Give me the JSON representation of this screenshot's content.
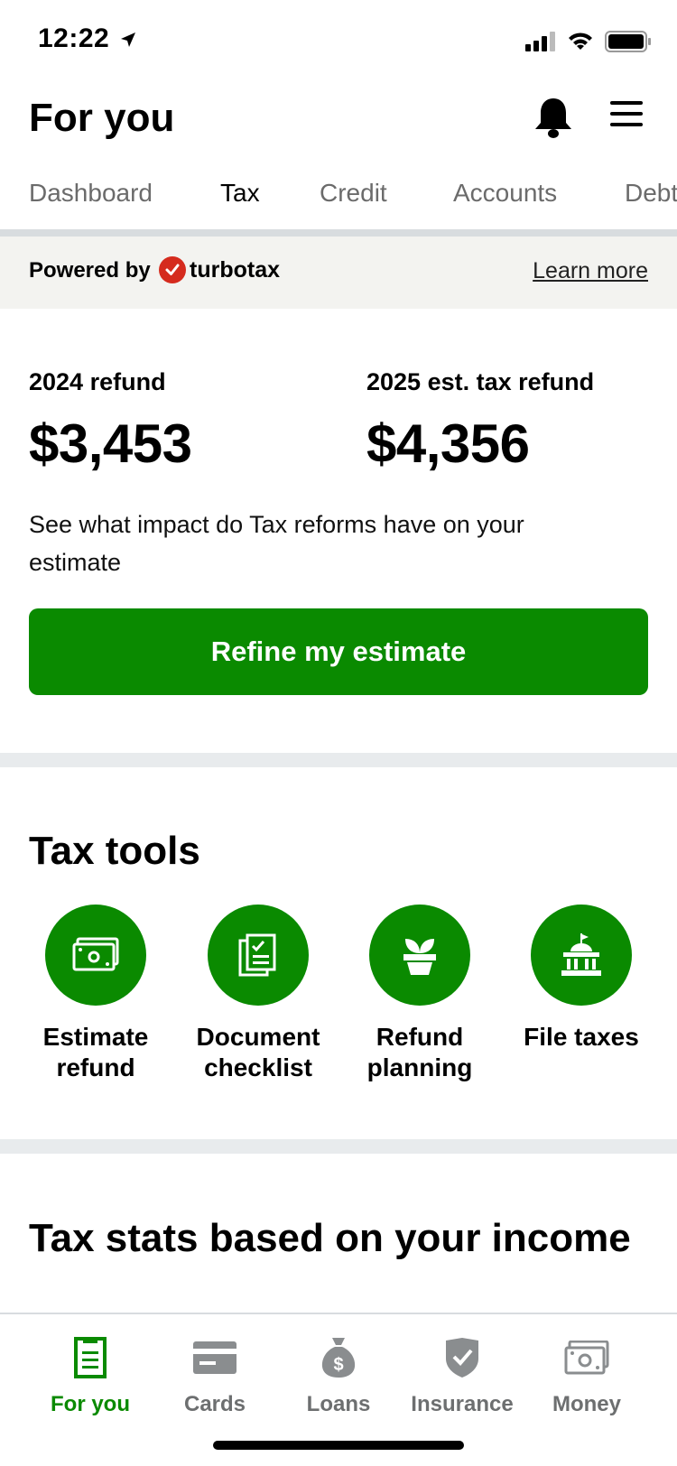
{
  "status_bar": {
    "time": "12:22"
  },
  "header": {
    "title": "For you"
  },
  "tabs": [
    {
      "label": "Dashboard"
    },
    {
      "label": "Tax"
    },
    {
      "label": "Credit"
    },
    {
      "label": "Accounts"
    },
    {
      "label": "Debt"
    }
  ],
  "active_tab": "Tax",
  "powered_by": {
    "label": "Powered by",
    "brand": "turbotax",
    "link": "Learn more"
  },
  "refunds": {
    "current": {
      "label": "2024 refund",
      "value": "$3,453"
    },
    "estimate": {
      "label": "2025 est. tax refund",
      "value": "$4,356"
    },
    "description": "See what impact do Tax reforms have on your estimate",
    "cta": "Refine my estimate"
  },
  "tax_tools": {
    "title": "Tax tools",
    "items": [
      {
        "label": "Estimate refund",
        "icon": "money-bill-icon"
      },
      {
        "label": "Document checklist",
        "icon": "checklist-icon"
      },
      {
        "label": "Refund planning",
        "icon": "plant-pot-icon"
      },
      {
        "label": "File taxes",
        "icon": "government-building-icon"
      }
    ]
  },
  "tax_stats": {
    "title": "Tax stats based on your income"
  },
  "bottom_nav": [
    {
      "label": "For you",
      "icon": "document-icon",
      "active": true
    },
    {
      "label": "Cards",
      "icon": "credit-card-icon"
    },
    {
      "label": "Loans",
      "icon": "money-bag-icon"
    },
    {
      "label": "Insurance",
      "icon": "shield-check-icon"
    },
    {
      "label": "Money",
      "icon": "money-bill-icon"
    }
  ],
  "colors": {
    "accent": "#0a8a00",
    "brand_red": "#d52b1e",
    "muted": "#6d6f70"
  }
}
